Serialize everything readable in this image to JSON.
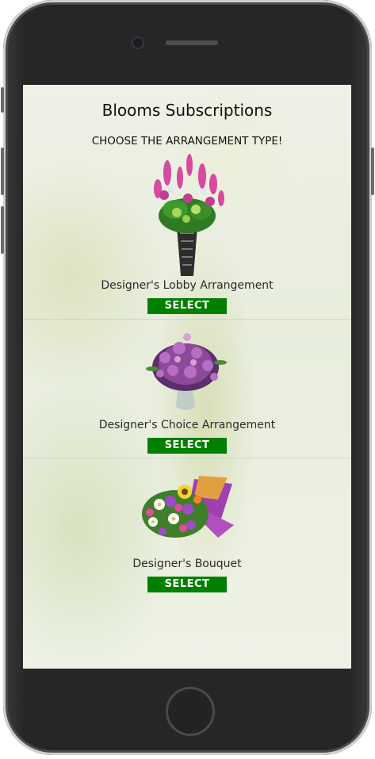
{
  "page": {
    "title": "Blooms Subscriptions",
    "subtitle": "CHOOSE THE ARRANGEMENT TYPE!"
  },
  "products": [
    {
      "name": "Designer's Lobby Arrangement",
      "select_label": "SELECT",
      "image_icon": "lobby-arrangement-image"
    },
    {
      "name": "Designer's Choice Arrangement",
      "select_label": "SELECT",
      "image_icon": "choice-arrangement-image"
    },
    {
      "name": "Designer's Bouquet",
      "select_label": "SELECT",
      "image_icon": "bouquet-image"
    }
  ],
  "colors": {
    "select_button": "#008000",
    "select_text": "#ffffff",
    "phone_body": "#262626"
  }
}
